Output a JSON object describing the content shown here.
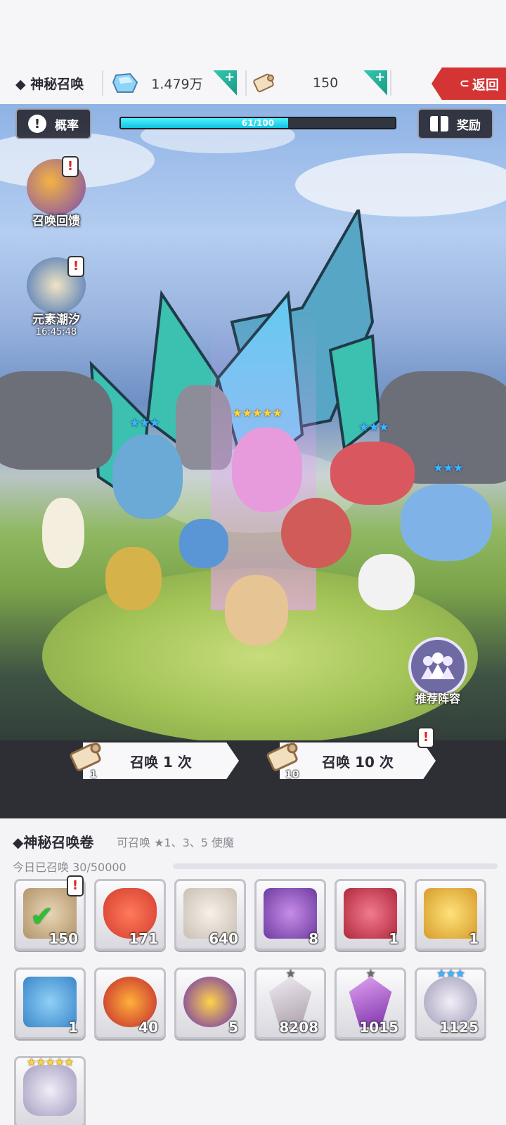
{
  "header": {
    "title": "◆ 神秘召唤",
    "gems": "1.479万",
    "scrolls": "150",
    "back_label": "返回",
    "plus": "+"
  },
  "scene": {
    "rate_label": "概率",
    "progress_text": "61/100",
    "progress_value": 0.61,
    "reward_label": "奖励",
    "feedback_label": "召唤回馈",
    "tide_label": "元素潮汐",
    "tide_timer": "16:45:48",
    "badge": "!",
    "recommend_label": "推荐阵容",
    "stars": {
      "three": "★★★",
      "five": "★★★★★",
      "one": "★"
    }
  },
  "summon": {
    "single_label": "召唤 1 次",
    "single_count": "1",
    "ten_label": "召唤 10 次",
    "ten_count": "10"
  },
  "inventory": {
    "title": "◆神秘召唤卷",
    "desc": "可召唤 ★1、3、5 使魔",
    "today": "今日已召唤 30/50000",
    "items": [
      {
        "name": "green-check-scroll",
        "count": "150"
      },
      {
        "name": "heart",
        "count": "171"
      },
      {
        "name": "white-scroll",
        "count": "640"
      },
      {
        "name": "purple-scroll",
        "count": "8"
      },
      {
        "name": "red-scroll",
        "count": "1"
      },
      {
        "name": "gold-scroll",
        "count": "1"
      },
      {
        "name": "blue-scroll",
        "count": "1"
      },
      {
        "name": "red-orb-scroll",
        "count": "40"
      },
      {
        "name": "purple-orb-scroll",
        "count": "5"
      },
      {
        "name": "white-crystal",
        "count": "8208"
      },
      {
        "name": "purple-crystal",
        "count": "1015"
      },
      {
        "name": "ring-crystal",
        "count": "1125"
      },
      {
        "name": "five-star-crystal",
        "count": ""
      }
    ]
  },
  "colors": {
    "accent": "#d53434",
    "teal": "#1a9a86",
    "progress": "#12c4e0"
  }
}
